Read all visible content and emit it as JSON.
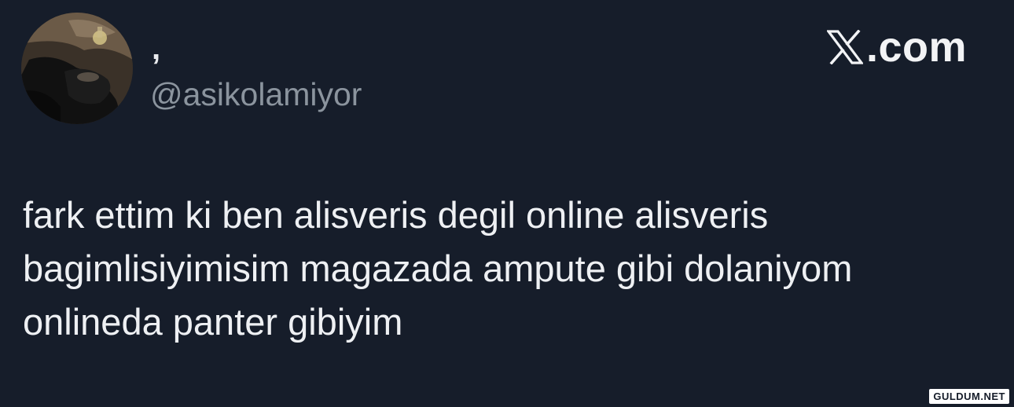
{
  "tweet": {
    "display_name": ",",
    "handle": "@asikolamiyor",
    "text": "fark ettim ki ben alisveris degil online alisveris\nbagimlisiyimisim magazada ampute gibi dolaniyom\nonlineda panter gibiyim"
  },
  "brand": {
    "label": ".com",
    "icon": "x-logo-icon"
  },
  "watermark": {
    "label": "GULDUM.NET"
  },
  "colors": {
    "background": "#161d2a",
    "text": "#eef0f3",
    "secondary_text": "#8b949e"
  }
}
